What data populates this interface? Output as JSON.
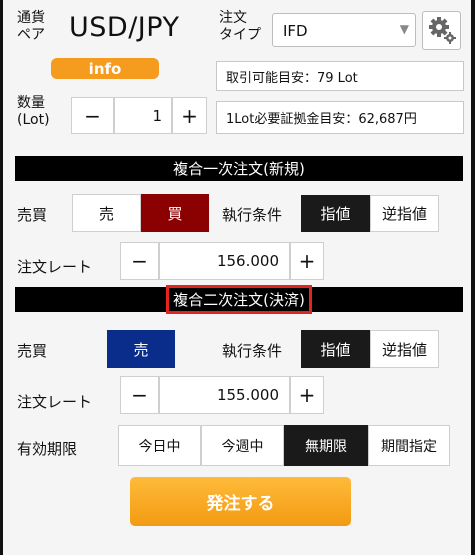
{
  "header": {
    "pair_label": "通貨\nペア",
    "pair": "USD/JPY",
    "order_type_label": "注文\nタイプ",
    "order_type_value": "IFD",
    "info_label": "info",
    "tradable_info": "取引可能目安：79 Lot",
    "margin_info": "1Lot必要証拠金目安：62,687円"
  },
  "quantity": {
    "label": "数量\n(Lot)",
    "minus": "−",
    "value": "1",
    "plus": "+"
  },
  "first_order": {
    "title": "複合一次注文(新規)",
    "side_label": "売買",
    "sell": "売",
    "buy": "買",
    "condition_label": "執行条件",
    "limit": "指値",
    "stop": "逆指値",
    "rate_label": "注文レート",
    "rate_minus": "−",
    "rate_value": "156.000",
    "rate_plus": "+"
  },
  "second_order": {
    "title": "複合二次注文(決済)",
    "side_label": "売買",
    "sell": "売",
    "condition_label": "執行条件",
    "limit": "指値",
    "stop": "逆指値",
    "rate_label": "注文レート",
    "rate_minus": "−",
    "rate_value": "155.000",
    "rate_plus": "+",
    "expiry_label": "有効期限",
    "expiry_options": [
      "今日中",
      "今週中",
      "無期限",
      "期間指定"
    ]
  },
  "submit_label": "発注する",
  "colors": {
    "buy_selected": "#8b0000",
    "sell_selected": "#0a2d8c",
    "submit": "#f5a623",
    "info": "#f59b1e",
    "highlight": "#e0261f"
  }
}
